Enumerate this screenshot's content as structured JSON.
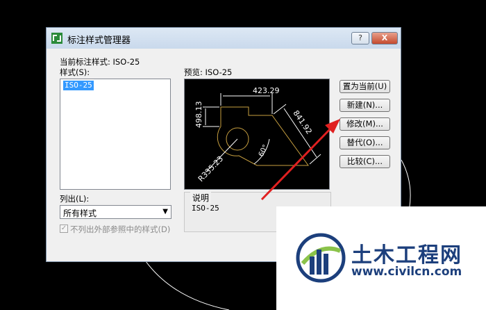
{
  "dialog": {
    "title": "标注样式管理器",
    "help_label": "?",
    "close_label": "X",
    "current_style_label": "当前标注样式: ISO-25",
    "styles_label": "样式(S):",
    "styles": [
      "ISO-25"
    ],
    "preview_label": "预览: ISO-25",
    "list_label": "列出(L):",
    "list_value": "所有样式",
    "exclude_xref_label": "不列出外部参照中的样式(D)",
    "exclude_xref_checked": true,
    "description_title": "说明",
    "description_value": "ISO-25",
    "buttons": {
      "set_current": "置为当前(U)",
      "new": "新建(N)...",
      "modify": "修改(M)...",
      "override": "替代(O)...",
      "compare": "比较(C)..."
    }
  },
  "preview": {
    "dim_top": "423.29",
    "dim_left": "498.13",
    "dim_right": "841.92",
    "dim_angle": "60°",
    "dim_radius": "R335.23"
  },
  "watermark": {
    "name": "土木工程网",
    "url": "www.civilcn.com"
  },
  "colors": {
    "annotation_arrow": "#e02020",
    "selection": "#3399ff",
    "geometry": "#c8a040"
  }
}
